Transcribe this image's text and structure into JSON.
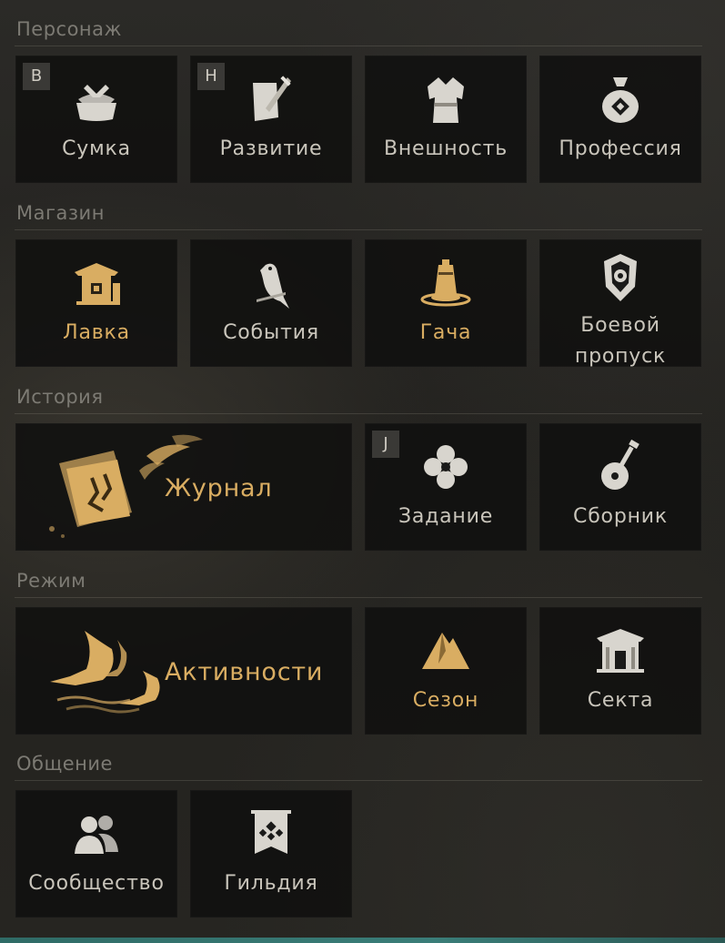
{
  "colors": {
    "label_default": "#c9c5bb",
    "label_highlight": "#d9ad62",
    "section_label": "#7c7a73",
    "tile_background": "#10100f"
  },
  "sections": {
    "character": {
      "title": "Персонаж",
      "items": [
        {
          "label": "Сумка",
          "hotkey": "B",
          "icon": "bag-icon"
        },
        {
          "label": "Развитие",
          "hotkey": "H",
          "icon": "sword-scroll-icon"
        },
        {
          "label": "Внешность",
          "icon": "robe-icon"
        },
        {
          "label": "Профессия",
          "icon": "money-pouch-icon"
        }
      ]
    },
    "shop": {
      "title": "Магазин",
      "items": [
        {
          "label": "Лавка",
          "icon": "shop-pavilion-icon",
          "highlight": true
        },
        {
          "label": "События",
          "icon": "bird-icon"
        },
        {
          "label": "Гача",
          "icon": "bell-icon",
          "highlight": true
        },
        {
          "label": "Боевой пропуск",
          "icon": "battle-pass-emblem-icon"
        }
      ]
    },
    "story": {
      "title": "История",
      "items": [
        {
          "label": "Журнал",
          "icon": "journal-papers-icon",
          "highlight": true
        },
        {
          "label": "Задание",
          "hotkey": "J",
          "icon": "quest-flower-icon"
        },
        {
          "label": "Сборник",
          "icon": "lute-icon"
        }
      ]
    },
    "mode": {
      "title": "Режим",
      "items": [
        {
          "label": "Активности",
          "icon": "cranes-icon",
          "highlight": true
        },
        {
          "label": "Сезон",
          "icon": "mountain-icon",
          "highlight": true
        },
        {
          "label": "Секта",
          "icon": "temple-gate-icon"
        }
      ]
    },
    "social": {
      "title": "Общение",
      "items": [
        {
          "label": "Сообщество",
          "icon": "people-icon"
        },
        {
          "label": "Гильдия",
          "icon": "guild-banner-icon"
        }
      ]
    }
  }
}
